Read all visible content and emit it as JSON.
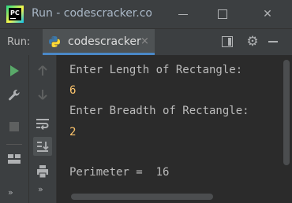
{
  "window": {
    "title": "Run - codescracker.com",
    "logo_text": "PC",
    "minimize": "minimize",
    "maximize": "maximize",
    "close": "✕"
  },
  "run_panel": {
    "label": "Run:",
    "tab_label": "codescracker",
    "tab_close": "×"
  },
  "console": {
    "lines": [
      {
        "text": "Enter Length of Rectangle:",
        "kind": "output"
      },
      {
        "text": "6",
        "kind": "input"
      },
      {
        "text": "Enter Breadth of Rectangle:",
        "kind": "output"
      },
      {
        "text": "2",
        "kind": "input"
      },
      {
        "text": "",
        "kind": "output"
      },
      {
        "text": "Perimeter =  16",
        "kind": "output"
      }
    ]
  },
  "toolbar": {
    "expand_outer": "»",
    "expand_inner": "»"
  },
  "icons": {
    "run": "play-icon",
    "settings": "gear-icon",
    "layout": "layout-icon",
    "hide": "minus-icon",
    "wrench": "wrench-icon",
    "stop": "stop-icon",
    "panels": "panels-icon",
    "up": "up-arrow-icon",
    "down": "down-arrow-icon",
    "soft_wrap": "soft-wrap-icon",
    "scroll_to_end": "scroll-to-end-icon",
    "print": "print-icon"
  },
  "colors": {
    "background": "#2b2b2b",
    "panel": "#3c3f41",
    "output_text": "#bbbbbb",
    "input_text": "#ffc66d",
    "run_green": "#59a869",
    "tab_accent": "#4a88c7"
  }
}
